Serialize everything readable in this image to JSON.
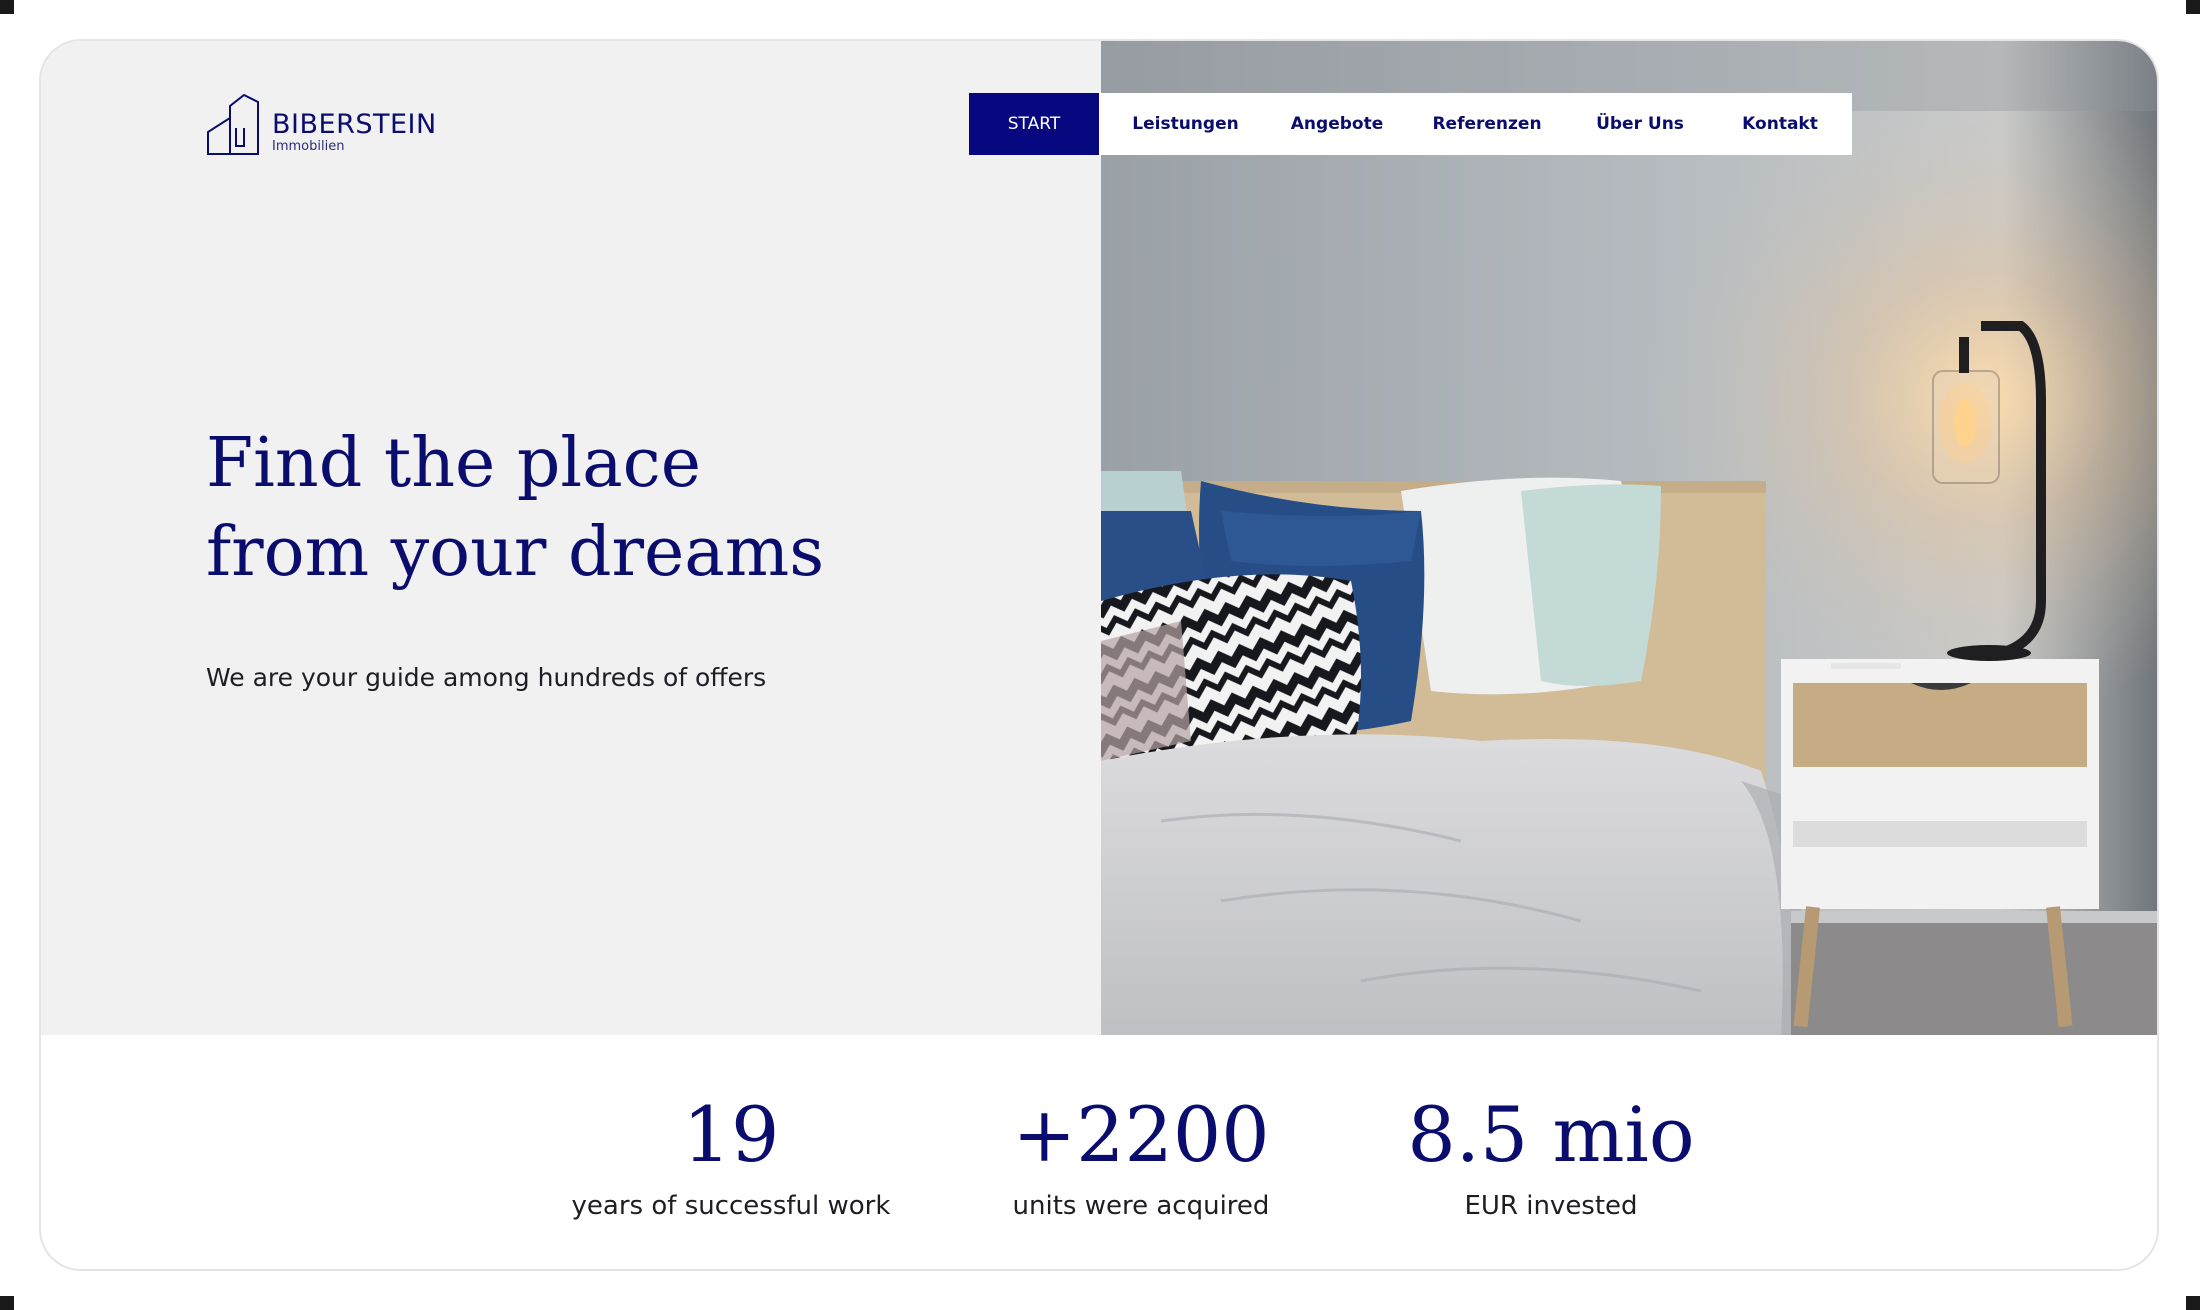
{
  "brand": {
    "name": "BIBERSTEIN",
    "subtitle": "Immobilien",
    "logo_icon": "house-outline-icon",
    "primary_color": "#0b0d6e",
    "active_nav_color": "#07087f"
  },
  "nav": {
    "items": [
      {
        "label": "START",
        "active": true
      },
      {
        "label": "Leistungen",
        "active": false
      },
      {
        "label": "Angebote",
        "active": false
      },
      {
        "label": "Referenzen",
        "active": false
      },
      {
        "label": "Über Uns",
        "active": false
      },
      {
        "label": "Kontakt",
        "active": false
      }
    ]
  },
  "hero": {
    "headline_line1": "Find the place",
    "headline_line2": "from your dreams",
    "subtitle": "We are your guide among hundreds of offers",
    "image_subject": "bedroom-photo"
  },
  "stats": [
    {
      "value": "19",
      "label": "years of successful work"
    },
    {
      "value": "+2200",
      "label": "units were acquired"
    },
    {
      "value": "8.5 mio",
      "label": "EUR invested"
    }
  ]
}
